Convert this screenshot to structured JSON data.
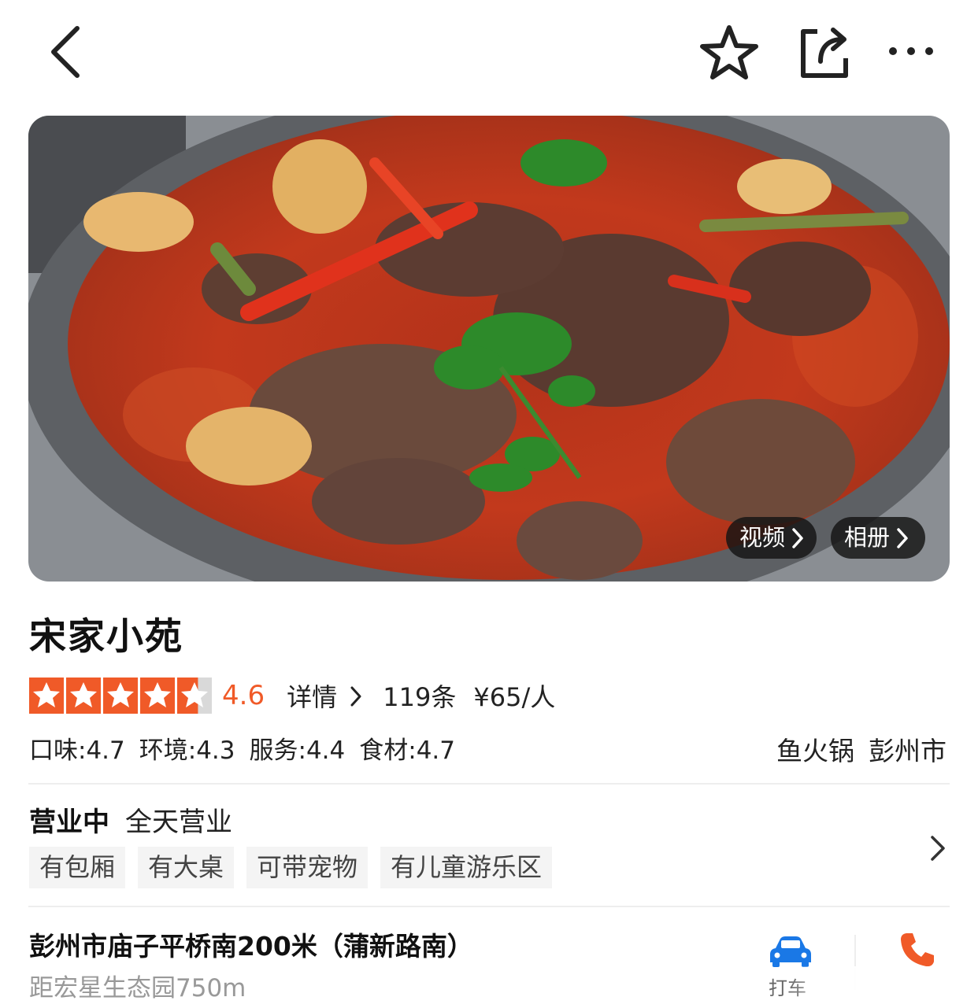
{
  "topbar": {
    "back_icon": "chevron-left-icon",
    "favorite_icon": "star-outline-icon",
    "share_icon": "share-icon",
    "more_icon": "more-dots-icon"
  },
  "hero": {
    "video_label": "视频",
    "album_label": "相册"
  },
  "shop": {
    "name": "宋家小苑",
    "rating": "4.6",
    "rating_value": 4.6,
    "star_color": "#f05a28",
    "details_label": "详情",
    "review_count": "119条",
    "price": "¥65/人",
    "subscores": [
      "口味:4.7",
      "环境:4.3",
      "服务:4.4",
      "食材:4.7"
    ],
    "category": "鱼火锅",
    "area": "彭州市"
  },
  "business": {
    "status": "营业中",
    "hours": "全天营业",
    "tags": [
      "有包厢",
      "有大桌",
      "可带宠物",
      "有儿童游乐区"
    ]
  },
  "location": {
    "address": "彭州市庙子平桥南200米（蒲新路南）",
    "distance": "距宏星生态园750m",
    "taxi_label": "打车",
    "taxi_color": "#1a78e6",
    "phone_color": "#f05a28"
  }
}
